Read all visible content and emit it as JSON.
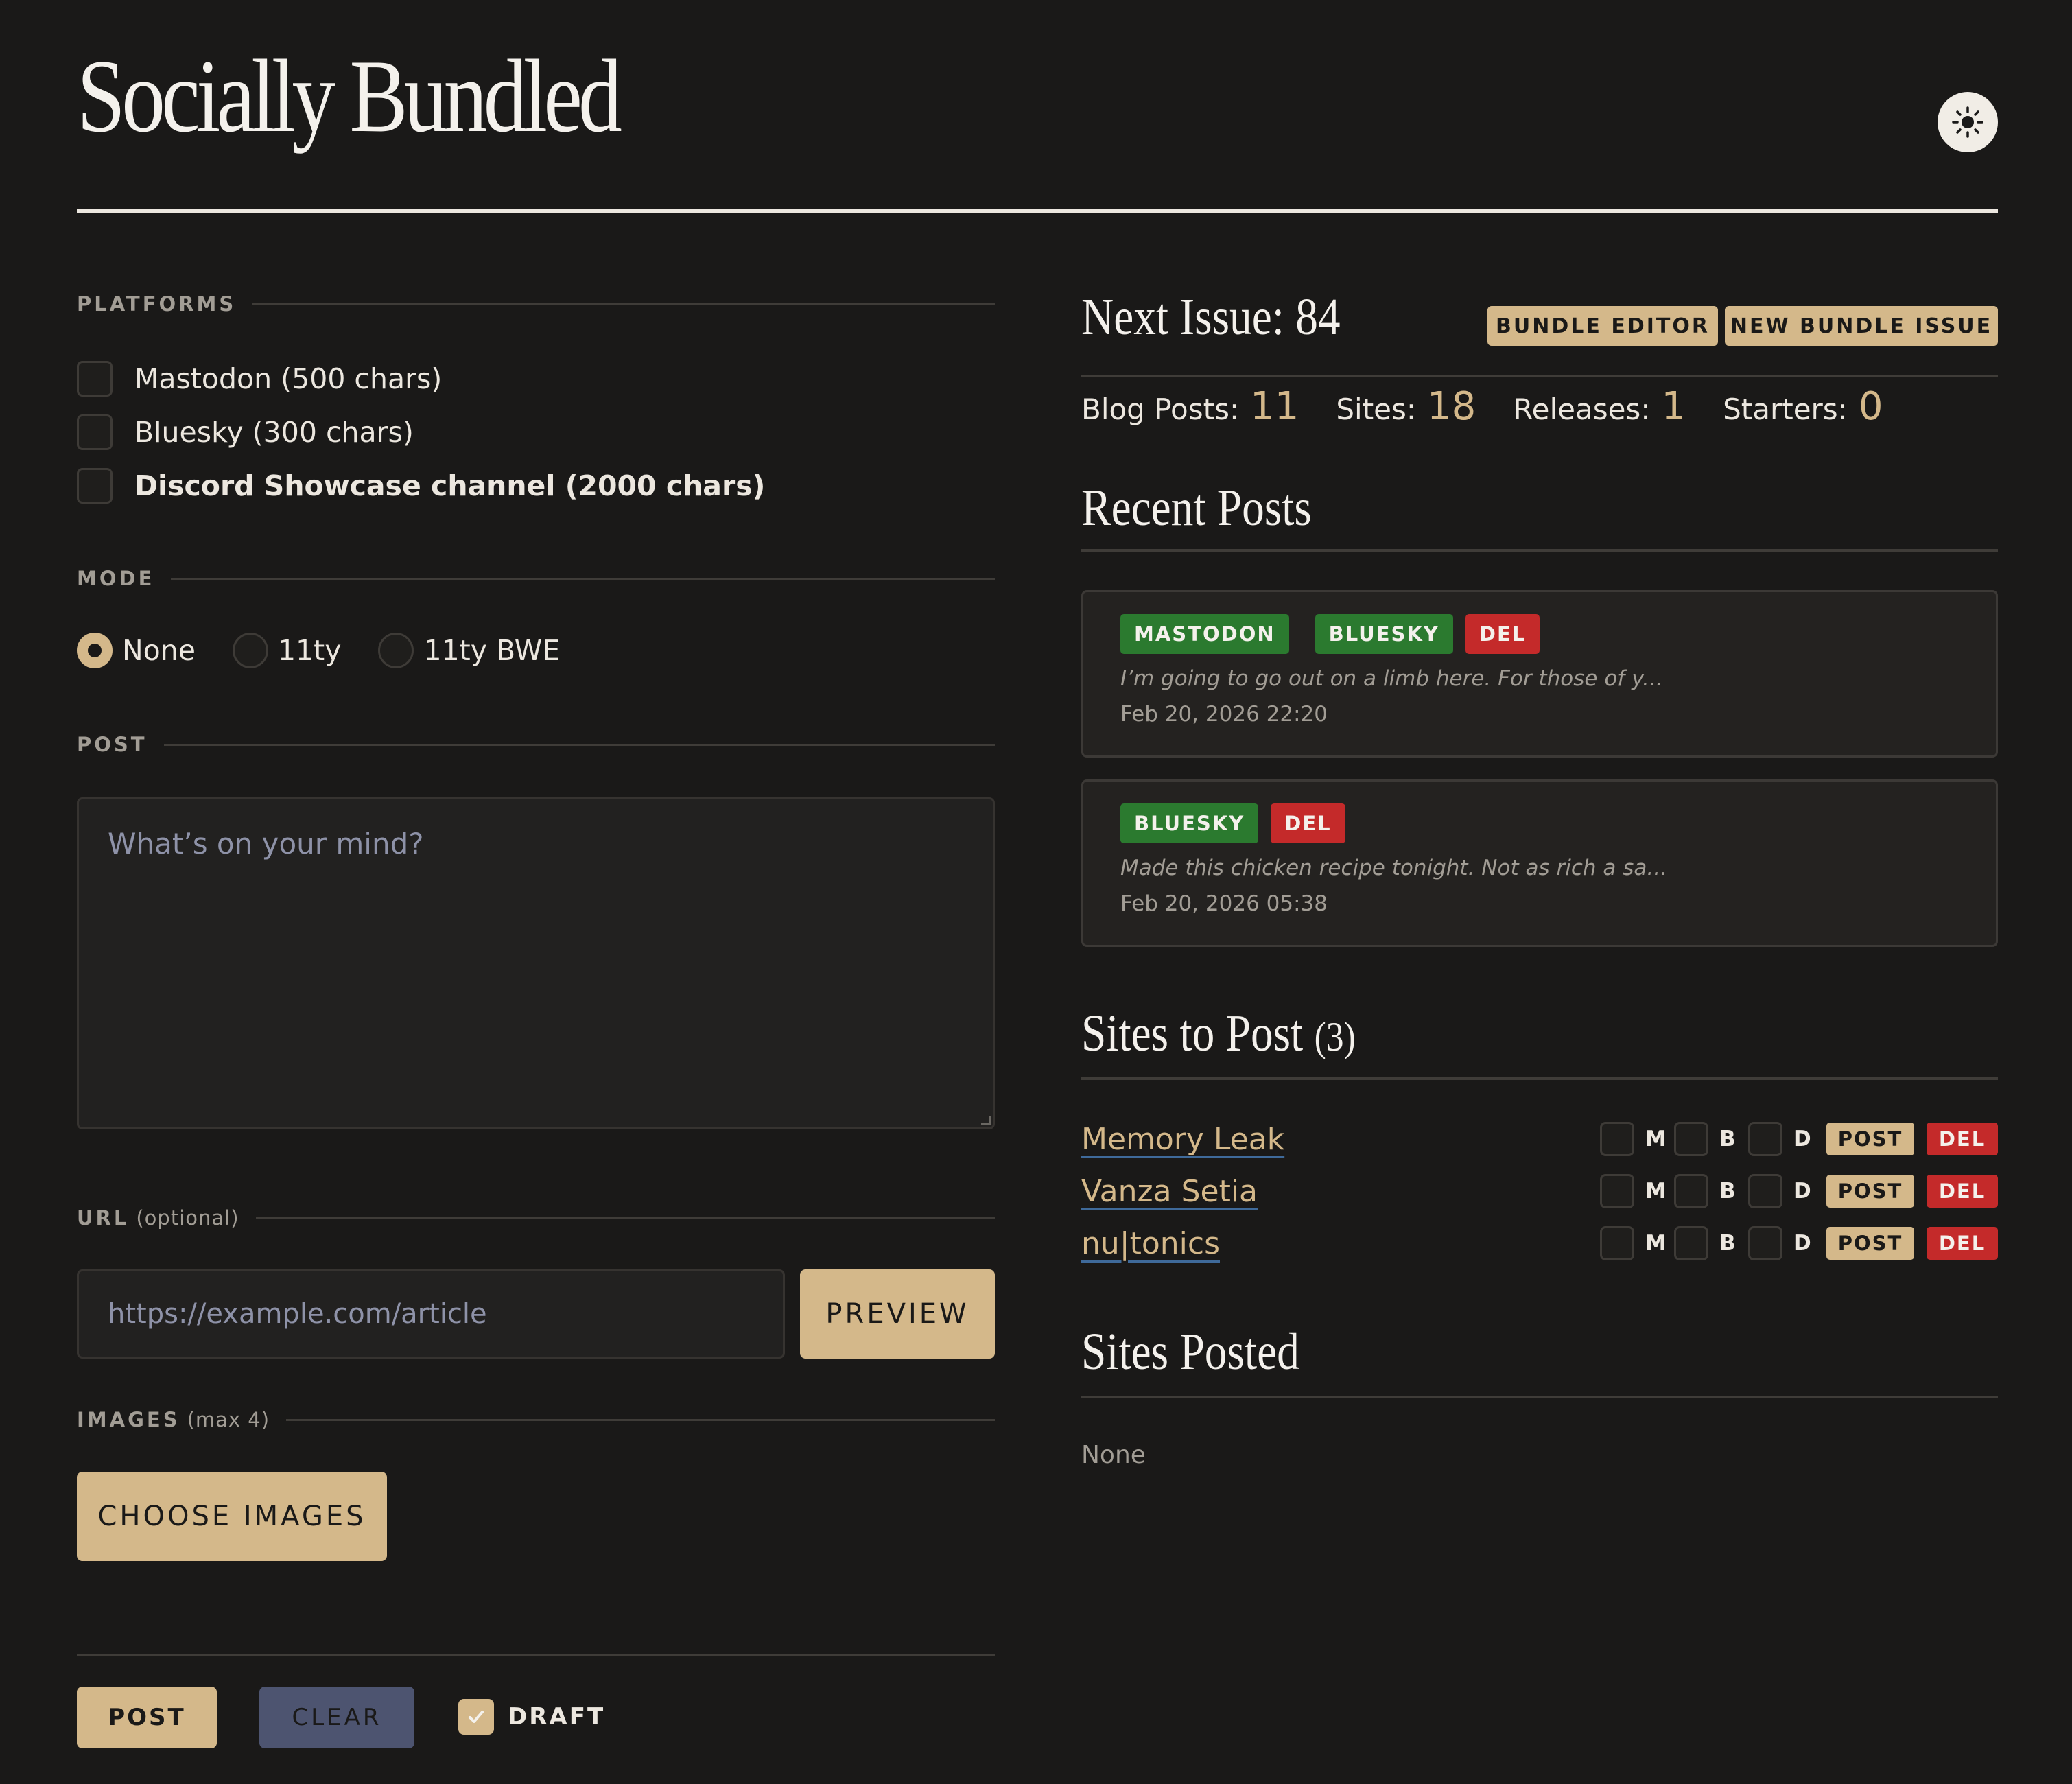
{
  "app": {
    "title": "Socially Bundled",
    "theme_icon": "sun-icon"
  },
  "platforms": {
    "label": "PLATFORMS",
    "items": [
      {
        "label": "Mastodon (500 chars)",
        "checked": false
      },
      {
        "label": "Bluesky (300 chars)",
        "checked": false
      },
      {
        "label": "Discord Showcase channel (2000 chars)",
        "checked": false
      }
    ]
  },
  "mode": {
    "label": "MODE",
    "options": [
      {
        "label": "None",
        "selected": true
      },
      {
        "label": "11ty",
        "selected": false
      },
      {
        "label": "11ty BWE",
        "selected": false
      }
    ]
  },
  "post": {
    "label": "POST",
    "placeholder": "What’s on your mind?",
    "value": ""
  },
  "url": {
    "label": "URL",
    "label_note": "(optional)",
    "placeholder": "https://example.com/article",
    "value": "",
    "preview_label": "PREVIEW"
  },
  "images": {
    "label": "IMAGES",
    "label_note": "(max 4)",
    "choose_label": "CHOOSE IMAGES"
  },
  "actions": {
    "post_label": "POST",
    "clear_label": "CLEAR",
    "draft_label": "DRAFT",
    "draft_checked": true
  },
  "issue": {
    "title": "Next Issue: 84",
    "bundle_editor_label": "BUNDLE EDITOR",
    "new_bundle_issue_label": "NEW BUNDLE ISSUE",
    "stats": [
      {
        "label": "Blog Posts:",
        "value": "11"
      },
      {
        "label": "Sites:",
        "value": "18"
      },
      {
        "label": "Releases:",
        "value": "1"
      },
      {
        "label": "Starters:",
        "value": "0"
      }
    ]
  },
  "recent_posts": {
    "title": "Recent Posts",
    "items": [
      {
        "badges": [
          "MASTODON",
          "BLUESKY"
        ],
        "delete_label": "DEL",
        "snippet": "I’m going to go out on a limb here. For those of y...",
        "time": "Feb 20, 2026 22:20"
      },
      {
        "badges": [
          "BLUESKY"
        ],
        "delete_label": "DEL",
        "snippet": "Made this chicken recipe tonight. Not as rich a sa...",
        "time": "Feb 20, 2026 05:38"
      }
    ]
  },
  "sites_to_post": {
    "title": "Sites to Post",
    "count": "(3)",
    "toggle_letters": [
      "M",
      "B",
      "D"
    ],
    "post_label": "POST",
    "delete_label": "DEL",
    "items": [
      {
        "name": "Memory Leak"
      },
      {
        "name": "Vanza Setia"
      },
      {
        "name": "nu|tonics"
      }
    ]
  },
  "sites_posted": {
    "title": "Sites Posted",
    "empty_text": "None"
  },
  "colors": {
    "background": "#1a1918",
    "accent": "#d4b88a",
    "green": "#2b7a2f",
    "red": "#c42a2a",
    "clear": "#4d5470"
  }
}
